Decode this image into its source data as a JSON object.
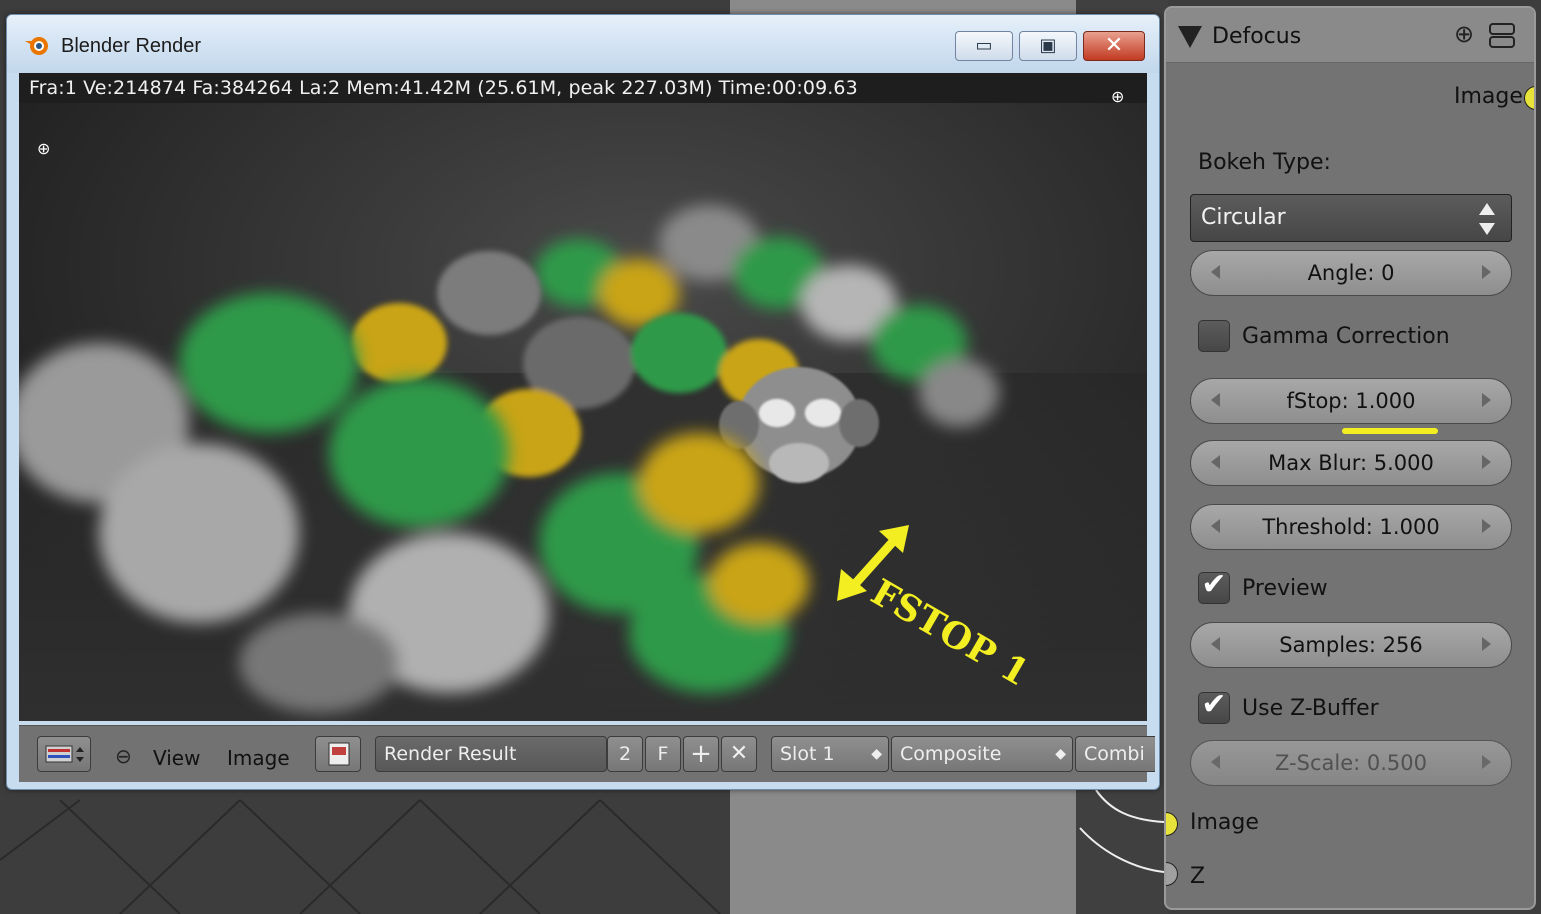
{
  "window": {
    "title": "Blender Render",
    "minimize_glyph": "▭",
    "maximize_glyph": "▣",
    "close_glyph": "✕"
  },
  "render": {
    "stats": "Fra:1  Ve:214874 Fa:384264 La:2 Mem:41.42M (25.61M, peak 227.03M) Time:00:09.63",
    "annotation": "FSTOP 1",
    "annotation_color": "#f2ee22"
  },
  "toolbar": {
    "view_label": "View",
    "image_label": "Image",
    "image_name": "Render Result",
    "users_count": "2",
    "fake_user": "F",
    "slot": "Slot 1",
    "layer": "Composite",
    "pass": "Combi"
  },
  "node": {
    "title": "Defocus",
    "output_image_label": "Image",
    "bokeh_type_label": "Bokeh Type:",
    "bokeh_type_value": "Circular",
    "angle": "Angle: 0",
    "gamma_label": "Gamma Correction",
    "gamma_checked": false,
    "fstop": "fStop: 1.000",
    "max_blur": "Max Blur: 5.000",
    "threshold": "Threshold: 1.000",
    "preview_label": "Preview",
    "preview_checked": true,
    "samples": "Samples: 256",
    "zbuffer_label": "Use Z-Buffer",
    "zbuffer_checked": true,
    "zscale": "Z-Scale: 0.500",
    "input_image_label": "Image",
    "input_z_label": "Z",
    "socket_color_image": "#e8e33a",
    "socket_color_value": "#a0a0a0",
    "highlight_color": "#f2ee22",
    "check_glyph": "✔"
  }
}
